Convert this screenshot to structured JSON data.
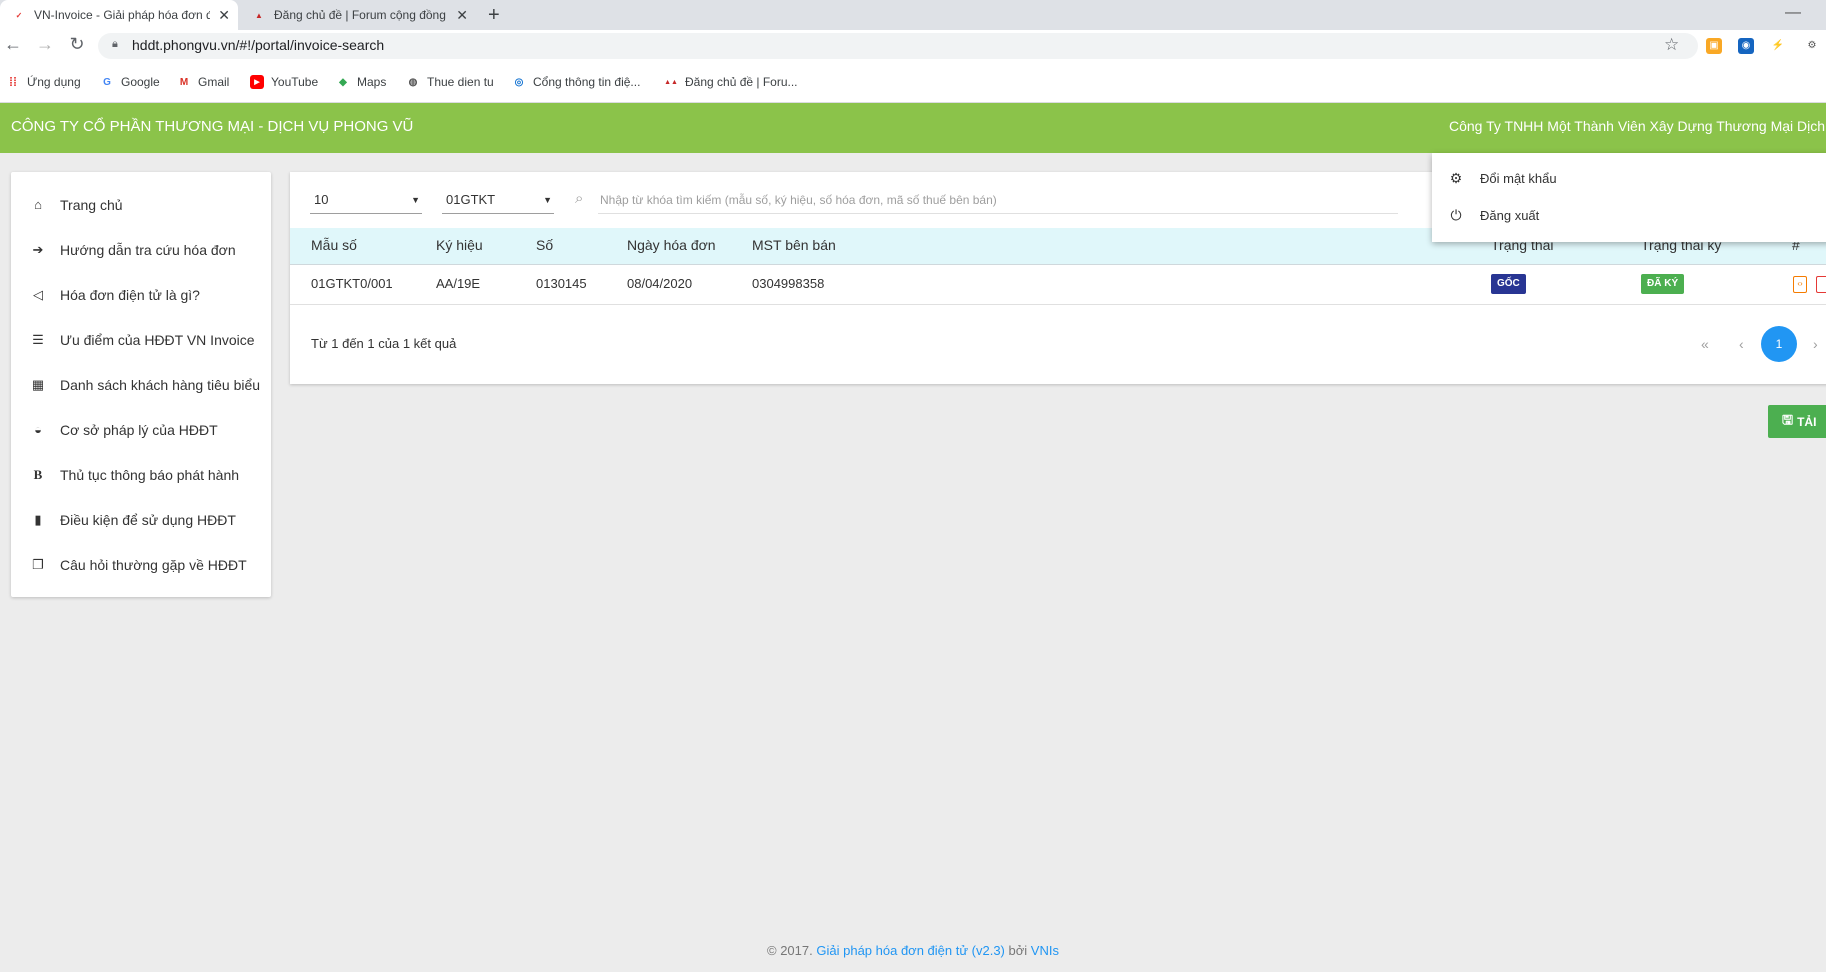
{
  "browser": {
    "tabs": [
      {
        "title": "VN-Invoice - Giải pháp hóa đơn điện tử"
      },
      {
        "title": "Đăng chủ đề | Forum cộng đồng"
      }
    ],
    "new_tab": "+",
    "url": "hddt.phongvu.vn/#!/portal/invoice-search",
    "bookmarks": [
      {
        "label": "Ứng dụng",
        "icon": "apps-grid-icon"
      },
      {
        "label": "Google",
        "icon": "google-icon"
      },
      {
        "label": "Gmail",
        "icon": "gmail-icon"
      },
      {
        "label": "YouTube",
        "icon": "youtube-icon"
      },
      {
        "label": "Maps",
        "icon": "maps-icon"
      },
      {
        "label": "Thue dien tu",
        "icon": "globe-icon"
      },
      {
        "label": "Cổng thông tin điệ...",
        "icon": "portal-icon"
      },
      {
        "label": "Đăng chủ đề | Foru...",
        "icon": "forum-icon"
      }
    ]
  },
  "header": {
    "company": "CÔNG TY CỔ PHẦN THƯƠNG MẠI - DỊCH VỤ PHONG VŨ",
    "user": "Công Ty TNHH Một Thành Viên Xây Dựng Thương Mại Dịch Vụ N",
    "color": "#8bc34a"
  },
  "user_menu": {
    "items": [
      {
        "label": "Đổi mật khẩu",
        "icon": "gear-icon"
      },
      {
        "label": "Đăng xuất",
        "icon": "power-icon"
      }
    ]
  },
  "sidebar": {
    "items": [
      {
        "label": "Trang chủ",
        "icon": "home-icon"
      },
      {
        "label": "Hướng dẫn tra cứu hóa đơn",
        "icon": "sign-in-icon"
      },
      {
        "label": "Hóa đơn điện tử là gì?",
        "icon": "megaphone-icon"
      },
      {
        "label": "Ưu điểm của HĐĐT VN Invoice",
        "icon": "list-icon"
      },
      {
        "label": "Danh sách khách hàng tiêu biểu",
        "icon": "table-icon"
      },
      {
        "label": "Cơ sở pháp lý của HĐĐT",
        "icon": "inbox-icon"
      },
      {
        "label": "Thủ tục thông báo phát hành",
        "icon": "bold-icon"
      },
      {
        "label": "Điều kiện để sử dụng HĐĐT",
        "icon": "book-icon"
      },
      {
        "label": "Câu hỏi thường gặp về HĐĐT",
        "icon": "copy-icon"
      }
    ]
  },
  "filters": {
    "page_size": "10",
    "template": "01GTKT",
    "search_placeholder": "Nhập từ khóa tìm kiếm (mẫu số, ký hiệu, số hóa đơn, mã số thuế bên bán)"
  },
  "table": {
    "columns": [
      "Mẫu số",
      "Ký hiệu",
      "Số",
      "Ngày hóa đơn",
      "MST bên bán",
      "Trạng thái",
      "Trạng thái ký",
      "#"
    ],
    "rows": [
      {
        "mau_so": "01GTKT0/001",
        "ky_hieu": "AA/19E",
        "so": "0130145",
        "ngay": "08/04/2020",
        "mst": "0304998358",
        "trang_thai": "GỐC",
        "trang_thai_ky": "ĐÃ KÝ",
        "actions": [
          "xml-file-icon",
          "pdf-file-icon"
        ]
      }
    ],
    "status_colors": {
      "goc": "#283593",
      "da_ky": "#4caf50"
    }
  },
  "pagination": {
    "summary": "Từ 1 đến 1 của 1 kết quả",
    "first": "«",
    "prev": "‹",
    "current": "1",
    "next": "›"
  },
  "download_button": {
    "label": "TẢI",
    "icon": "save-icon"
  },
  "footer": {
    "prefix": "© 2017.",
    "link": "Giải pháp hóa đơn điện tử (v2.3)",
    "by": "bởi",
    "vendor": "VNIs"
  }
}
